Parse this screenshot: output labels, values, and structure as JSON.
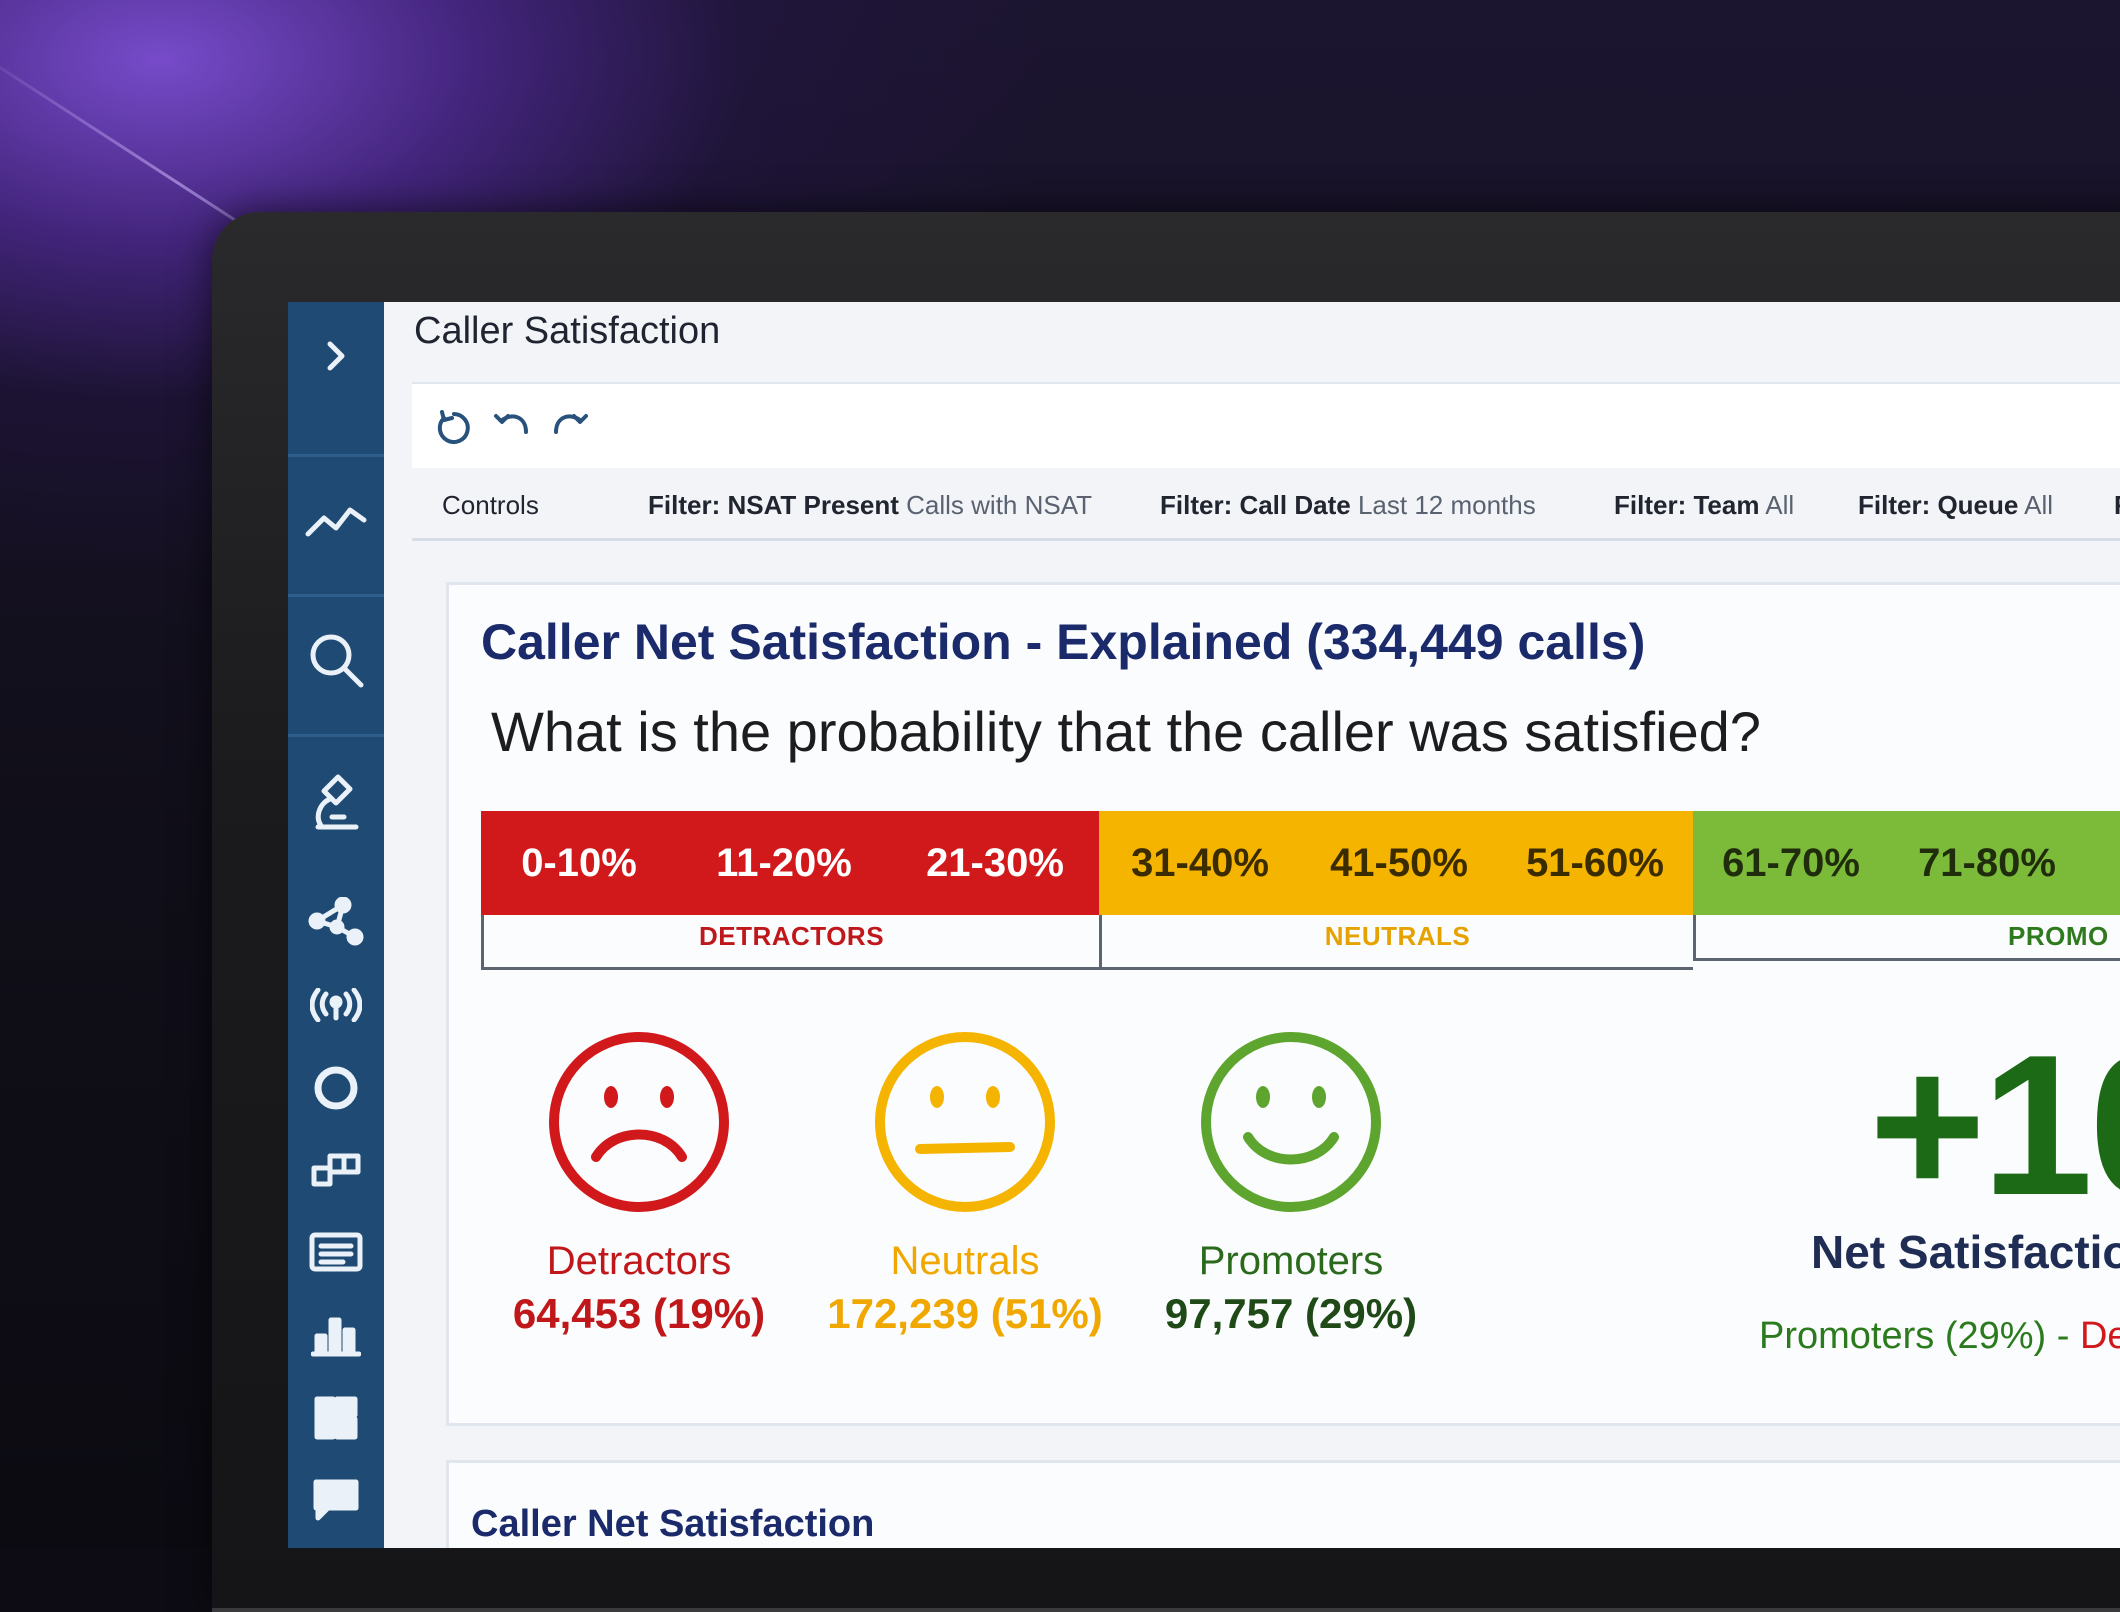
{
  "window": {
    "title": "Caller Satisfaction"
  },
  "sidebar": {
    "icons": [
      "chevron-right-icon",
      "trend-line-icon",
      "search-icon",
      "microscope-icon",
      "network-icon",
      "broadcast-icon",
      "ring-icon",
      "blocks-icon",
      "list-panel-icon",
      "bar-chart-icon",
      "layout-icon",
      "chat-bubble-icon"
    ]
  },
  "toolbar": {
    "icons": [
      "refresh-icon",
      "undo-icon",
      "redo-icon"
    ]
  },
  "filters": {
    "controls": "Controls",
    "nsat": {
      "key": "Filter: NSAT Present",
      "value": "Calls with NSAT"
    },
    "call_date": {
      "key": "Filter: Call Date",
      "value": "Last 12 months"
    },
    "team": {
      "key": "Filter: Team",
      "value": "All"
    },
    "queue": {
      "key": "Filter: Queue",
      "value": "All"
    },
    "more": "F"
  },
  "card": {
    "title": "Caller Net Satisfaction - Explained (334,449 calls)",
    "question": "What is the probability that the caller was satisfied?",
    "scale": [
      "0-10%",
      "11-20%",
      "21-30%",
      "31-40%",
      "41-50%",
      "51-60%",
      "61-70%",
      "71-80%",
      ""
    ],
    "groups": {
      "detractors": "DETRACTORS",
      "neutrals": "NEUTRALS",
      "promoters": "PROMO"
    },
    "faces": {
      "detractors": {
        "label": "Detractors",
        "value": "64,453 (19%)"
      },
      "neutrals": {
        "label": "Neutrals",
        "value": "172,239 (51%)"
      },
      "promoters": {
        "label": "Promoters",
        "value": "97,757 (29%)"
      }
    },
    "net": {
      "value": "+10",
      "label": "Net Satisfactio",
      "formula_promoters": "Promoters (29%)",
      "formula_sep": " - ",
      "formula_detractors": "De"
    }
  },
  "card2": {
    "title": "Caller Net Satisfaction"
  },
  "colors": {
    "detractor_red": "#d1191c",
    "neutral_yellow": "#f5b400",
    "promoter_green": "#7cba3a",
    "sidebar": "#1e4a74",
    "title_navy": "#1b2a6b"
  }
}
